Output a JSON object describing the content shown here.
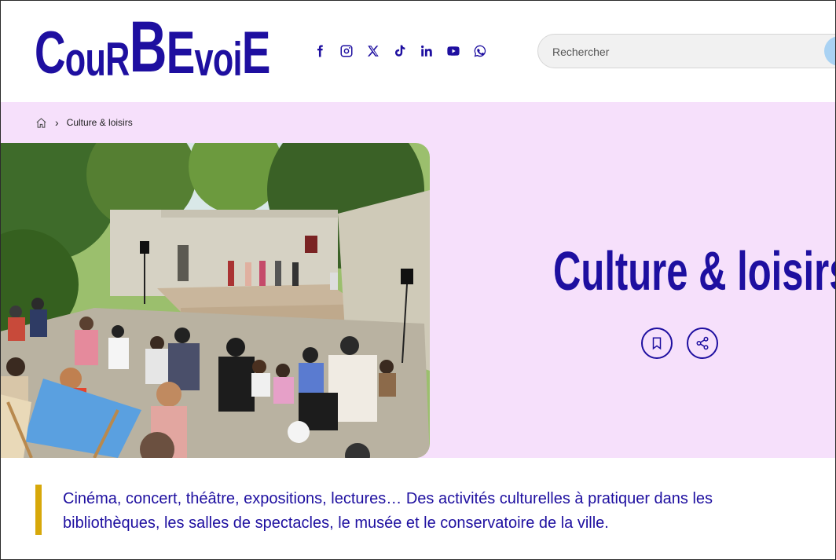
{
  "header": {
    "logo": {
      "letters": [
        "C",
        "o",
        "u",
        "R",
        "B",
        "E",
        "v",
        "o",
        "i",
        "E"
      ]
    },
    "socials": [
      {
        "name": "facebook-icon"
      },
      {
        "name": "instagram-icon"
      },
      {
        "name": "x-icon"
      },
      {
        "name": "tiktok-icon"
      },
      {
        "name": "linkedin-icon"
      },
      {
        "name": "youtube-icon"
      },
      {
        "name": "whatsapp-icon"
      }
    ],
    "search": {
      "placeholder": "Rechercher"
    }
  },
  "breadcrumb": {
    "current": "Culture & loisirs"
  },
  "hero": {
    "title": "Culture & loisirs"
  },
  "intro": {
    "text": "Cinéma, concert, théâtre, expositions, lectures… Des activités culturelles à pratiquer dans les bibliothèques, les salles de spectacles, le musée et le conservatoire de la ville."
  },
  "colors": {
    "brand": "#1e0fa0",
    "hero_bg": "#f6e0fb",
    "accent": "#d7a80a"
  }
}
